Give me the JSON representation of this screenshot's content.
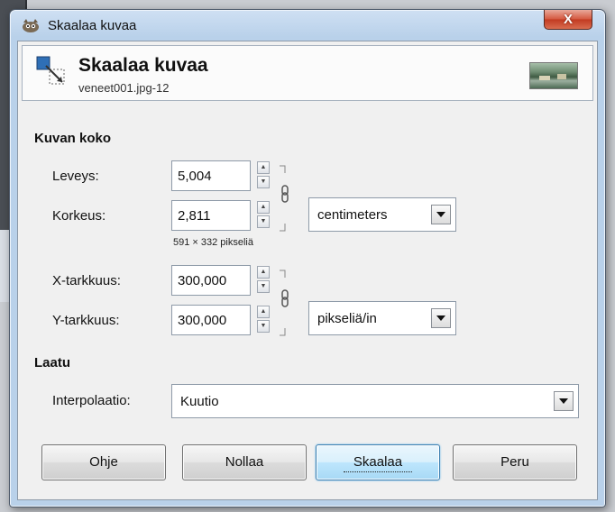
{
  "window": {
    "title": "Skaalaa kuvaa",
    "close_label": "X"
  },
  "header": {
    "title": "Skaalaa kuvaa",
    "subtitle": "veneet001.jpg-12"
  },
  "image_size": {
    "section_title": "Kuvan koko",
    "width_label": "Leveys:",
    "width_value": "5,004",
    "height_label": "Korkeus:",
    "height_value": "2,811",
    "unit_selected": "centimeters",
    "pixels_note": "591 × 332 pikseliä",
    "xres_label": "X-tarkkuus:",
    "xres_value": "300,000",
    "yres_label": "Y-tarkkuus:",
    "yres_value": "300,000",
    "res_unit_selected": "pikseliä/in"
  },
  "quality": {
    "section_title": "Laatu",
    "interp_label": "Interpolaatio:",
    "interp_selected": "Kuutio"
  },
  "buttons": {
    "help": "Ohje",
    "reset": "Nollaa",
    "scale": "Skaalaa",
    "cancel": "Peru"
  }
}
